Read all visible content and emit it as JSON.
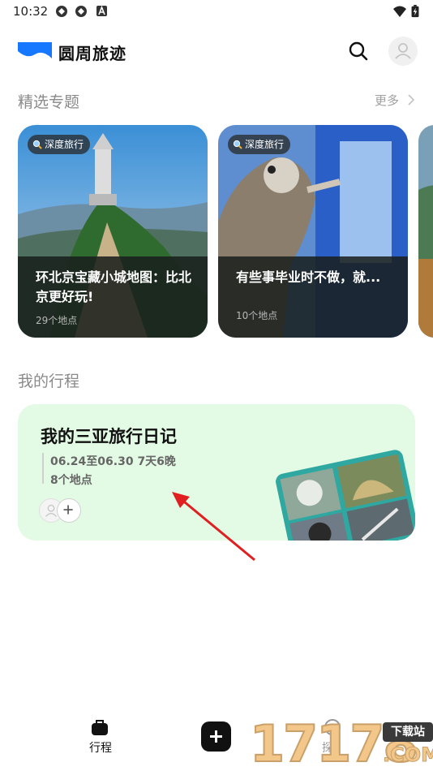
{
  "status_bar": {
    "time": "10:32",
    "icons": [
      "sync-icon",
      "sync-icon",
      "a-notification-icon",
      "wifi-icon",
      "battery-charging-icon"
    ]
  },
  "header": {
    "app_name": "圆周旅迹",
    "logo_color": "#1677ff",
    "icons": [
      "search-icon",
      "user-avatar-icon"
    ]
  },
  "featured": {
    "title": "精选专题",
    "more_label": "更多",
    "cards": [
      {
        "badge": "深度旅行",
        "title": "环北京宝藏小城地图：比北京更好玩!",
        "count": "29个地点"
      },
      {
        "badge": "深度旅行",
        "title": "有些事毕业时不做，就...",
        "count": "10个地点"
      }
    ]
  },
  "my_trips": {
    "title": "我的行程",
    "trip": {
      "title": "我的三亚旅行日记",
      "dates": "06.24至06.30 7天6晚",
      "places": "8个地点",
      "background": "#e3fae4"
    }
  },
  "bottom_nav": {
    "items": [
      {
        "label": "行程",
        "icon": "suitcase-icon"
      },
      {
        "label": "",
        "icon": "plus-icon"
      },
      {
        "label": "探",
        "icon": "explore-icon"
      }
    ]
  },
  "watermark": {
    "digits": "17178",
    "tag": "下载站",
    "suffix": ".COM"
  },
  "colors": {
    "accent": "#1677ff",
    "trip_card_bg": "#e3fae4",
    "annotation_arrow": "#e02020"
  }
}
